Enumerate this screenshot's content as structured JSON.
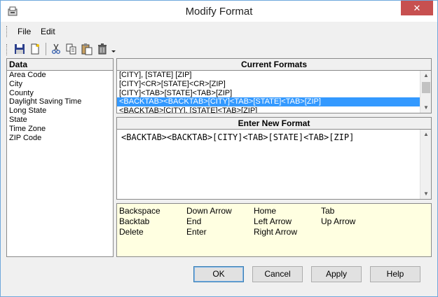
{
  "window": {
    "title": "Modify Format",
    "close_symbol": "✕"
  },
  "menu": {
    "items": [
      "File",
      "Edit"
    ]
  },
  "toolbar": {
    "icons": [
      "save-icon",
      "new-icon",
      "cut-icon",
      "copy-icon",
      "paste-icon",
      "delete-icon",
      "dropdown-icon"
    ]
  },
  "data_panel": {
    "header": "Data",
    "items": [
      "Area Code",
      "City",
      "County",
      "Daylight Saving Time",
      "Long State",
      "State",
      "Time Zone",
      "ZIP Code"
    ]
  },
  "current_formats": {
    "header": "Current Formats",
    "items": [
      "[CITY], [STATE] [ZIP]",
      "[CITY]<CR>[STATE]<CR>[ZIP]",
      "[CITY]<TAB>[STATE]<TAB>[ZIP]",
      "<BACKTAB><BACKTAB>[CITY]<TAB>[STATE]<TAB>[ZIP]",
      "<BACKTAB>[CITY], [STATE]<TAB>[ZIP]"
    ],
    "selected_index": 3
  },
  "new_format": {
    "header": "Enter New Format",
    "value": "<BACKTAB><BACKTAB>[CITY]<TAB>[STATE]<TAB>[ZIP]"
  },
  "keys": {
    "col1": [
      "Backspace",
      "Backtab",
      "Delete"
    ],
    "col2": [
      "Down Arrow",
      "End",
      "Enter"
    ],
    "col3": [
      "Home",
      "Left Arrow",
      "Right Arrow"
    ],
    "col4": [
      "Tab",
      "Up Arrow"
    ]
  },
  "buttons": {
    "ok": "OK",
    "cancel": "Cancel",
    "apply": "Apply",
    "help": "Help"
  },
  "colors": {
    "selection": "#3399ff",
    "keys_background": "#ffffe1",
    "close_button": "#c75050"
  }
}
